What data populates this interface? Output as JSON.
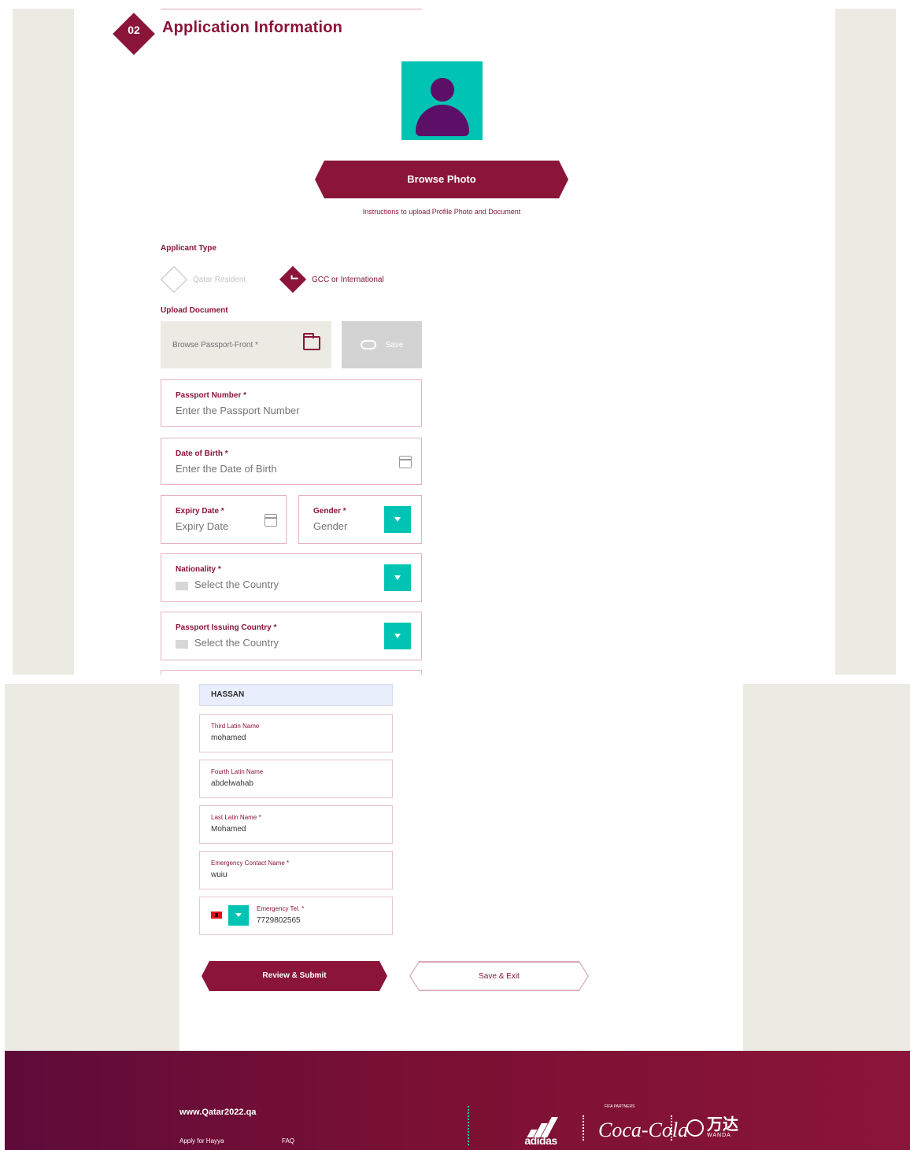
{
  "section": {
    "step": "02",
    "title": "Application Information"
  },
  "photo": {
    "browse_label": "Browse Photo",
    "instructions": "Instructions to upload Profile Photo and Document"
  },
  "applicant_type": {
    "label": "Applicant Type",
    "options": [
      {
        "label": "Qatar Resident",
        "selected": false
      },
      {
        "label": "GCC or International",
        "selected": true
      }
    ]
  },
  "upload": {
    "label": "Upload Document",
    "browse_placeholder": "Browse Passport-Front *",
    "save_label": "Save"
  },
  "form": {
    "passport_number": {
      "label": "Passport Number *",
      "placeholder": "Enter the Passport Number"
    },
    "dob": {
      "label": "Date of Birth *",
      "placeholder": "Enter the Date of Birth"
    },
    "expiry": {
      "label": "Expiry Date *",
      "placeholder": "Expiry Date"
    },
    "gender": {
      "label": "Gender *",
      "placeholder": "Gender"
    },
    "nationality": {
      "label": "Nationality *",
      "placeholder": "Select the Country"
    },
    "issuing_country": {
      "label": "Passport Issuing Country *",
      "placeholder": "Select the Country"
    }
  },
  "names": {
    "second_value": "HASSAN",
    "third": {
      "label": "Third Latin Name",
      "value": "mohamed"
    },
    "fourth": {
      "label": "Fourth Latin Name",
      "value": "abdelwahab"
    },
    "last": {
      "label": "Last Latin Name *",
      "value": "Mohamed"
    },
    "emergency_name": {
      "label": "Emergency Contact Name *",
      "value": "wuiu"
    },
    "emergency_tel": {
      "label": "Emergency Tel. *",
      "value": "7729802565"
    }
  },
  "actions": {
    "review_label": "Review & Submit",
    "save_exit_label": "Save & Exit"
  },
  "footer": {
    "site": "www.Qatar2022.qa",
    "links": [
      "Apply for Hayya",
      "FAQ"
    ],
    "partners_label": "FIFA PARTNERS",
    "adidas": "adidas",
    "coke": "Coca-Cola",
    "wanda_cn": "万达",
    "wanda_en": "WANDA"
  },
  "colors": {
    "brand": "#8a1538",
    "accent": "#00c4b3",
    "panel": "#ecebe3",
    "avatar_figure": "#5c0f66"
  }
}
